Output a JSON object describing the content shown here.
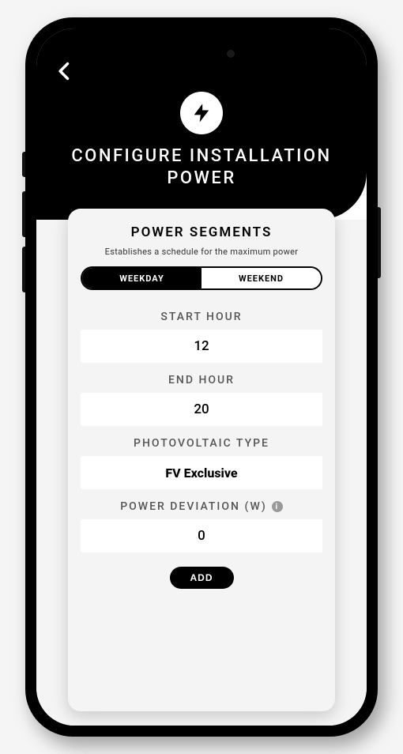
{
  "header": {
    "title": "CONFIGURE INSTALLATION POWER"
  },
  "card": {
    "title": "POWER SEGMENTS",
    "subtitle": "Establishes a schedule for the maximum power",
    "segments": {
      "weekday": "WEEKDAY",
      "weekend": "WEEKEND",
      "active": "weekday"
    },
    "fields": {
      "start_hour": {
        "label": "START HOUR",
        "value": "12"
      },
      "end_hour": {
        "label": "END HOUR",
        "value": "20"
      },
      "pv_type": {
        "label": "PHOTOVOLTAIC TYPE",
        "value": "FV Exclusive"
      },
      "power_dev": {
        "label": "POWER DEVIATION (W)",
        "value": "0"
      }
    },
    "add_button": "ADD"
  }
}
